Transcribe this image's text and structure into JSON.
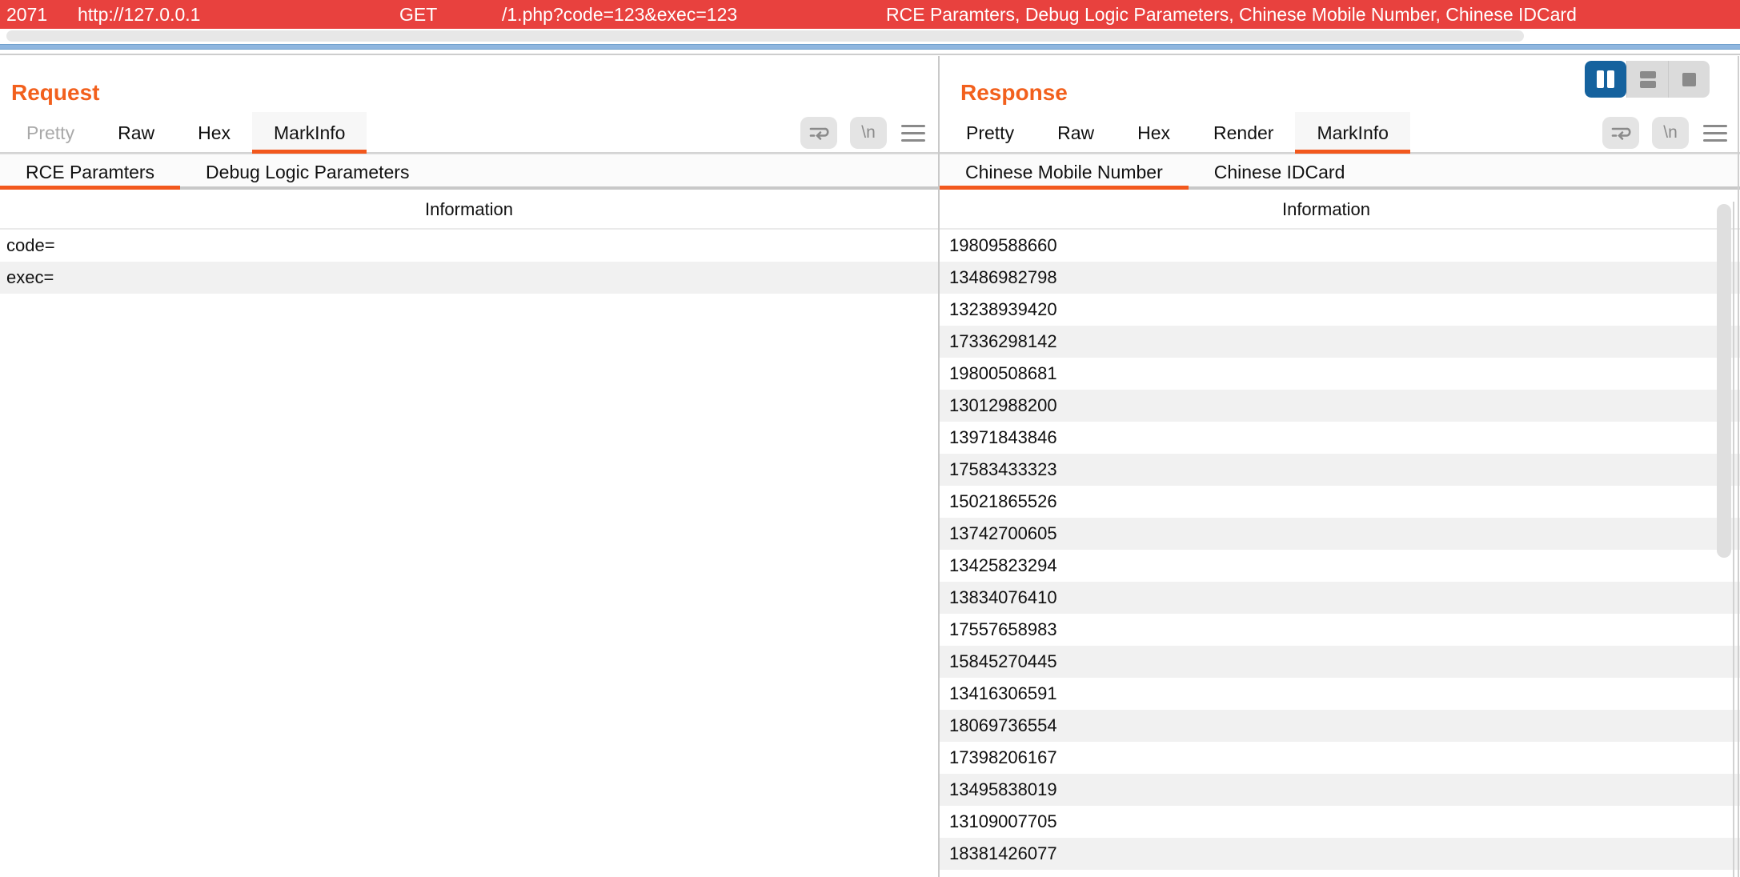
{
  "colors": {
    "history_highlight_red": "#E8413E",
    "accent_orange": "#F2601D",
    "tab_underline_orange": "#F2581D",
    "active_view_blue": "#15629E",
    "strip_blue": "#8FB6DF",
    "alt_row_gray": "#F1F1F1"
  },
  "history_row": {
    "id": "2071",
    "host": "http://127.0.0.1",
    "method": "GET",
    "url": "/1.php?code=123&exec=123",
    "tags": "RCE Paramters, Debug Logic Parameters, Chinese Mobile Number, Chinese IDCard"
  },
  "request": {
    "title": "Request",
    "tabs": [
      {
        "label": "Pretty",
        "disabled": true
      },
      {
        "label": "Raw"
      },
      {
        "label": "Hex"
      },
      {
        "label": "MarkInfo",
        "active": true
      }
    ],
    "tools": {
      "newline_label": "\\n"
    },
    "subtabs": [
      {
        "label": "RCE Paramters",
        "active": true
      },
      {
        "label": "Debug Logic Parameters"
      }
    ],
    "table": {
      "header": "Information",
      "rows": [
        "code=",
        "exec="
      ]
    }
  },
  "response": {
    "title": "Response",
    "view_toggle": [
      {
        "name": "split-columns",
        "active": true
      },
      {
        "name": "split-rows"
      },
      {
        "name": "single-pane"
      }
    ],
    "tabs": [
      {
        "label": "Pretty"
      },
      {
        "label": "Raw"
      },
      {
        "label": "Hex"
      },
      {
        "label": "Render"
      },
      {
        "label": "MarkInfo",
        "active": true
      }
    ],
    "tools": {
      "newline_label": "\\n"
    },
    "subtabs": [
      {
        "label": "Chinese Mobile Number",
        "active": true
      },
      {
        "label": "Chinese IDCard"
      }
    ],
    "table": {
      "header": "Information",
      "rows": [
        "19809588660",
        "13486982798",
        "13238939420",
        "17336298142",
        "19800508681",
        "13012988200",
        "13971843846",
        "17583433323",
        "15021865526",
        "13742700605",
        "13425823294",
        "13834076410",
        "17557658983",
        "15845270445",
        "13416306591",
        "18069736554",
        "17398206167",
        "13495838019",
        "13109007705",
        "18381426077"
      ]
    }
  }
}
